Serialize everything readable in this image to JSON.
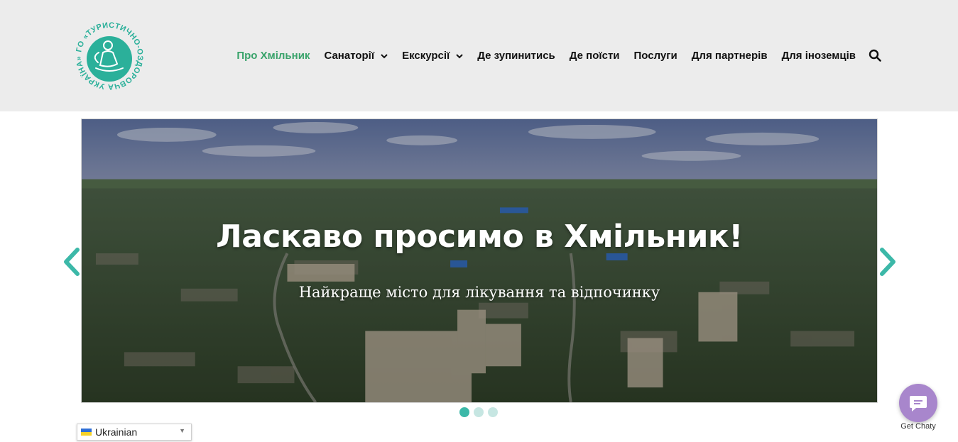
{
  "logo": {
    "text": "ГО «ТУРИСТИЧНО-ОЗДОРОВЧА УКРАЇНА»",
    "accent": "#2bb09a"
  },
  "nav": {
    "items": [
      {
        "label": "Про Хмільник",
        "active": true
      },
      {
        "label": "Санаторії",
        "dropdown": true
      },
      {
        "label": "Екскурсії",
        "dropdown": true
      },
      {
        "label": "Де зупинитись"
      },
      {
        "label": "Де поїсти"
      },
      {
        "label": "Послуги"
      },
      {
        "label": "Для партнерів"
      },
      {
        "label": "Для іноземців"
      }
    ],
    "search_icon": "search-icon",
    "active_color": "#3aa36b"
  },
  "slider": {
    "title": "Ласкаво просимо в Хмільник!",
    "subtitle": "Найкраще місто для лікування та відпочинку",
    "slides_count": 3,
    "active_slide": 1,
    "accent": "#3cb8a8"
  },
  "language": {
    "selected": "Ukrainian"
  },
  "chat": {
    "label": "Get Chaty",
    "color": "#a886cc"
  }
}
